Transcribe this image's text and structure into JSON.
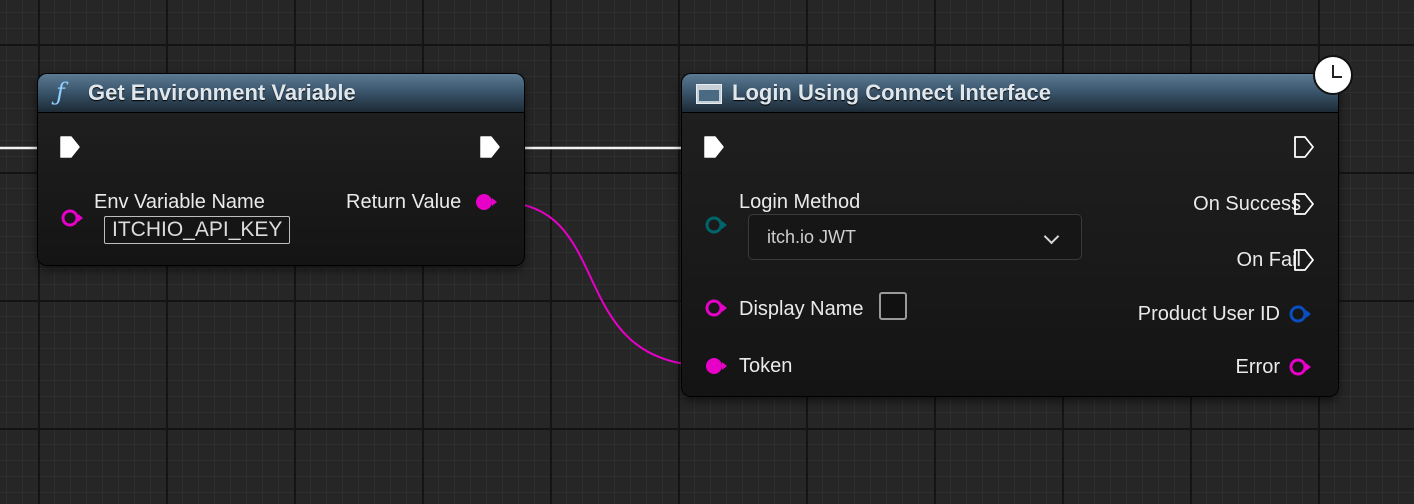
{
  "get_env_node": {
    "icon": "function-icon",
    "title": "Get Environment Variable",
    "input_label": "Env Variable Name",
    "input_value": "ITCHIO_API_KEY",
    "output_label": "Return Value"
  },
  "login_node": {
    "icon": "widget-icon",
    "title": "Login Using Connect Interface",
    "login_method_label": "Login Method",
    "login_method_value": "itch.io JWT",
    "display_name_label": "Display Name",
    "display_name_checked": false,
    "token_label": "Token",
    "outputs": {
      "on_success": "On Success",
      "on_fail": "On Fail",
      "product_user_id": "Product User ID",
      "error": "Error"
    },
    "latent_icon": "clock-icon"
  },
  "colors": {
    "string_pin": "#e600c8",
    "enum_pin": "#00656a",
    "struct_pin": "#0a4ec2",
    "exec_pin": "#ffffff",
    "header_top": "#5b7a93",
    "function_icon": "#8fcfff"
  }
}
